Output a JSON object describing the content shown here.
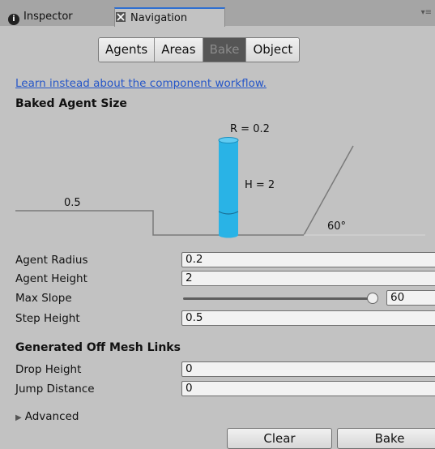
{
  "tabs": {
    "inspector": "Inspector",
    "navigation": "Navigation",
    "menu_glyph": "▾≡"
  },
  "segments": [
    "Agents",
    "Areas",
    "Bake",
    "Object"
  ],
  "active_segment": "Bake",
  "link_text": "Learn instead about the component workflow.",
  "baked_agent_size": {
    "heading": "Baked Agent Size",
    "radius_label": "R = 0.2",
    "height_label": "H = 2",
    "step_label": "0.5",
    "slope_label": "60°"
  },
  "fields": {
    "agent_radius": {
      "label": "Agent Radius",
      "value": "0.2"
    },
    "agent_height": {
      "label": "Agent Height",
      "value": "2"
    },
    "max_slope": {
      "label": "Max Slope",
      "value": "60",
      "fraction": 0.98
    },
    "step_height": {
      "label": "Step Height",
      "value": "0.5"
    }
  },
  "off_mesh": {
    "heading": "Generated Off Mesh Links",
    "drop_height": {
      "label": "Drop Height",
      "value": "0"
    },
    "jump_distance": {
      "label": "Jump Distance",
      "value": "0"
    }
  },
  "advanced_label": "Advanced",
  "buttons": {
    "clear": "Clear",
    "bake": "Bake"
  },
  "colors": {
    "agent_cylinder": "#29b3e6",
    "link": "#2556c8",
    "active_tab_border": "#2e6fd1"
  }
}
